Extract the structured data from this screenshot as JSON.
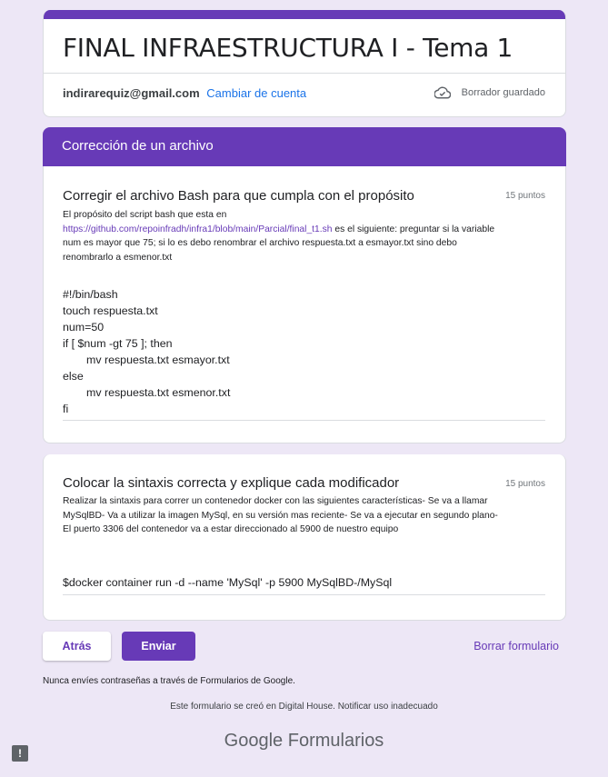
{
  "form": {
    "title": "FINAL INFRAESTRUCTURA I - Tema 1",
    "account_email": "indirarequiz@gmail.com",
    "switch_account": "Cambiar de cuenta",
    "draft_status": "Borrador guardado"
  },
  "section": {
    "title": "Corrección de un archivo"
  },
  "questions": [
    {
      "title": "Corregir el archivo Bash para que cumpla con el propósito",
      "points": "15 puntos",
      "desc_before": "El propósito del script bash que esta en",
      "desc_link": "https://github.com/repoinfradh/infra1/blob/main/Parcial/final_t1.sh",
      "desc_after": " es el siguiente: preguntar si la variable num es mayor que 75; si lo es debo renombrar el archivo respuesta.txt a esmayor.txt sino debo renombrarlo a esmenor.txt",
      "answer_lines": [
        "#!/bin/bash",
        "touch respuesta.txt",
        "num=50",
        "if [ $num -gt 75 ]; then",
        "mv respuesta.txt esmayor.txt",
        "else",
        "mv respuesta.txt esmenor.txt",
        "fi"
      ]
    },
    {
      "title": "Colocar la sintaxis correcta y explique cada modificador",
      "points": "15 puntos",
      "desc": "Realizar la sintaxis para correr un contenedor docker con las siguientes características- Se va a llamar MySqlBD- Va a utilizar la imagen MySql, en su versión mas reciente- Se va a ejecutar en segundo plano- El puerto 3306 del contenedor va a estar direccionado al 5900 de nuestro equipo",
      "answer": "$docker container run -d --name 'MySql'  -p 5900 MySqlBD-/MySql"
    }
  ],
  "buttons": {
    "back": "Atrás",
    "send": "Enviar",
    "clear": "Borrar formulario"
  },
  "footer": {
    "warning": "Nunca envíes contraseñas a través de Formularios de Google.",
    "note": "Este formulario se creó en Digital House. Notificar uso inadecuado",
    "brand_google": "Google",
    "brand_product": "Formularios"
  },
  "icons": {
    "cloud": "cloud-done-icon",
    "feedback": "report-icon"
  }
}
